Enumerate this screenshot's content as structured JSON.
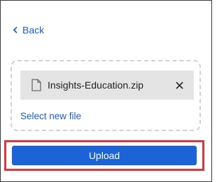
{
  "nav": {
    "back_label": "Back"
  },
  "file": {
    "name": "Insights-Education.zip",
    "icon": "file-icon",
    "remove_icon": "close-icon"
  },
  "actions": {
    "select_new_label": "Select new file",
    "upload_label": "Upload"
  },
  "colors": {
    "link": "#1a5fd0",
    "primary_button": "#1b63d6",
    "highlight_border": "#e2343b",
    "file_chip_bg": "#e4e4e4"
  }
}
